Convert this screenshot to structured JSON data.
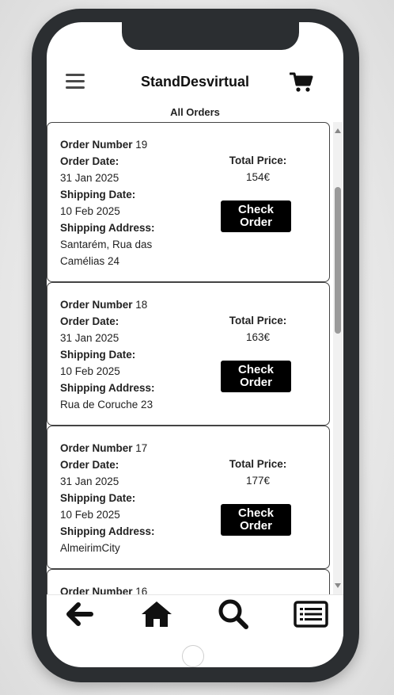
{
  "header": {
    "app_title": "StandDesvirtual",
    "menu_icon": "hamburger-menu-icon",
    "cart_icon": "shopping-cart-icon"
  },
  "orders_section": {
    "title": "All Orders"
  },
  "labels": {
    "order_number": "Order Number",
    "order_date": "Order Date:",
    "shipping_date": "Shipping Date:",
    "shipping_address": "Shipping Address:",
    "total_price": "Total Price:",
    "check_order": "Check Order"
  },
  "orders": [
    {
      "number": "19",
      "order_date": "31 Jan 2025",
      "shipping_date": "10 Feb 2025",
      "address_line1": "Santarém, Rua das",
      "address_line2": "Camélias 24",
      "total_price": "154€"
    },
    {
      "number": "18",
      "order_date": "31 Jan 2025",
      "shipping_date": "10 Feb 2025",
      "address_line1": "Rua de Coruche 23",
      "address_line2": "",
      "total_price": "163€"
    },
    {
      "number": "17",
      "order_date": "31 Jan 2025",
      "shipping_date": "10 Feb 2025",
      "address_line1": "AlmeirimCity",
      "address_line2": "",
      "total_price": "177€"
    },
    {
      "number": "16",
      "order_date": "",
      "shipping_date": "",
      "address_line1": "",
      "address_line2": "",
      "total_price": ""
    }
  ],
  "bottom_nav": {
    "items": [
      "back-arrow-icon",
      "home-icon",
      "search-icon",
      "orders-list-icon"
    ]
  },
  "colors": {
    "phone_frame": "#2b2e31",
    "button_bg": "#000000",
    "button_text": "#ffffff"
  }
}
